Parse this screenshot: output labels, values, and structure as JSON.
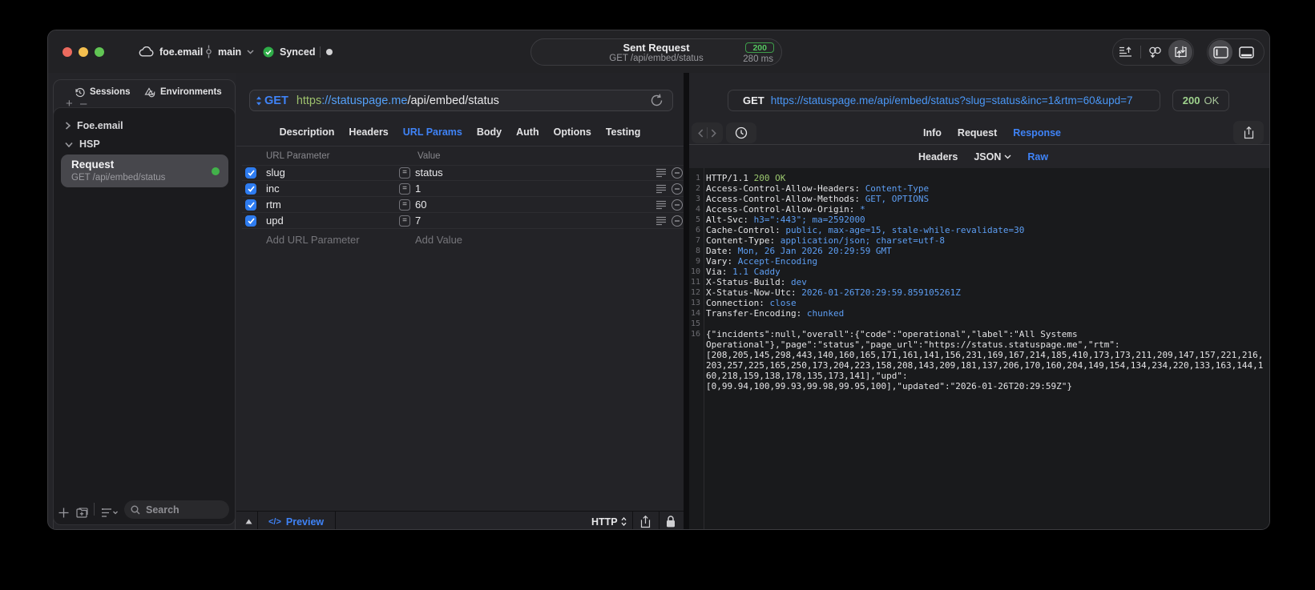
{
  "colors": {
    "accent_blue": "#3f83f7",
    "success_green": "#42b24a",
    "status_green": "#9fd38d",
    "url_scheme_green": "#9dc06d",
    "url_host_blue": "#54a0f8",
    "header_value_blue": "#5d9ef3"
  },
  "titlebar": {
    "project": "foe.email",
    "branch": "main",
    "sync_status": "Synced",
    "sent_request": {
      "title": "Sent Request",
      "subtitle": "GET /api/embed/status",
      "status_code": "200",
      "duration": "280 ms"
    }
  },
  "sidebar": {
    "tabs": [
      {
        "label": "Sessions",
        "icon": "history-icon"
      },
      {
        "label": "Environments",
        "icon": "environments-icon"
      }
    ],
    "tree": [
      {
        "label": "Foe.email",
        "expanded": false
      },
      {
        "label": "HSP",
        "expanded": true
      }
    ],
    "selected_request": {
      "name": "Request",
      "summary": "GET /api/embed/status"
    },
    "search_placeholder": "Search",
    "add_button": "+",
    "remove_button": "–"
  },
  "request_editor": {
    "method": "GET",
    "url": {
      "scheme": "https",
      "host": "://statuspage.me",
      "path": "/api/embed/status"
    },
    "tabs": [
      "Description",
      "Headers",
      "URL Params",
      "Body",
      "Auth",
      "Options",
      "Testing"
    ],
    "active_tab": "URL Params",
    "params": {
      "columns": {
        "name": "URL Parameter",
        "value": "Value"
      },
      "rows": [
        {
          "name": "slug",
          "value": "status",
          "enabled": true
        },
        {
          "name": "inc",
          "value": "1",
          "enabled": true
        },
        {
          "name": "rtm",
          "value": "60",
          "enabled": true
        },
        {
          "name": "upd",
          "value": "7",
          "enabled": true
        }
      ],
      "equals_glyph": "=",
      "add_name_placeholder": "Add URL Parameter",
      "add_value_placeholder": "Add Value"
    },
    "footer": {
      "preview": "Preview",
      "code_glyph": "</>",
      "protocol": "HTTP"
    }
  },
  "response_viewer": {
    "request_line": {
      "method": "GET",
      "url": "https://statuspage.me/api/embed/status?slug=status&inc=1&rtm=60&upd=7"
    },
    "status": {
      "code": "200",
      "text": "OK"
    },
    "tabs": [
      "Info",
      "Request",
      "Response"
    ],
    "active_tab": "Response",
    "subtabs": [
      "Headers",
      "JSON",
      "Raw"
    ],
    "active_subtab": "Raw",
    "dropdown_subtab": "JSON",
    "raw": {
      "status_line": {
        "protocol": "HTTP/1.1",
        "status": "200 OK"
      },
      "headers": [
        {
          "name": "Access-Control-Allow-Headers",
          "value": "Content-Type"
        },
        {
          "name": "Access-Control-Allow-Methods",
          "value": "GET, OPTIONS"
        },
        {
          "name": "Access-Control-Allow-Origin",
          "value": "*"
        },
        {
          "name": "Alt-Svc",
          "value": "h3=\":443\"; ma=2592000"
        },
        {
          "name": "Cache-Control",
          "value": "public, max-age=15, stale-while-revalidate=30"
        },
        {
          "name": "Content-Type",
          "value": "application/json; charset=utf-8"
        },
        {
          "name": "Date",
          "value": "Mon, 26 Jan 2026 20:29:59 GMT"
        },
        {
          "name": "Vary",
          "value": "Accept-Encoding"
        },
        {
          "name": "Via",
          "value": "1.1 Caddy"
        },
        {
          "name": "X-Status-Build",
          "value": "dev"
        },
        {
          "name": "X-Status-Now-Utc",
          "value": "2026-01-26T20:29:59.859105261Z"
        },
        {
          "name": "Connection",
          "value": "close"
        },
        {
          "name": "Transfer-Encoding",
          "value": "chunked"
        }
      ],
      "body_lines": [
        "{\"incidents\":null,\"overall\":{\"code\":\"operational\",\"label\":\"All Systems",
        "Operational\"},\"page\":\"status\",\"page_url\":\"https://status.statuspage.me\",\"rtm\":",
        "[208,205,145,298,443,140,160,165,171,161,141,156,231,169,167,214,185,410,173,173,211,209,147,157,221,216,",
        "203,257,225,165,250,173,204,223,158,208,143,209,181,137,206,170,160,204,149,154,134,234,220,133,163,144,1",
        "60,218,159,138,178,135,173,141],\"upd\":",
        "[0,99.94,100,99.93,99.98,99.95,100],\"updated\":\"2026-01-26T20:29:59Z\"}"
      ]
    }
  }
}
